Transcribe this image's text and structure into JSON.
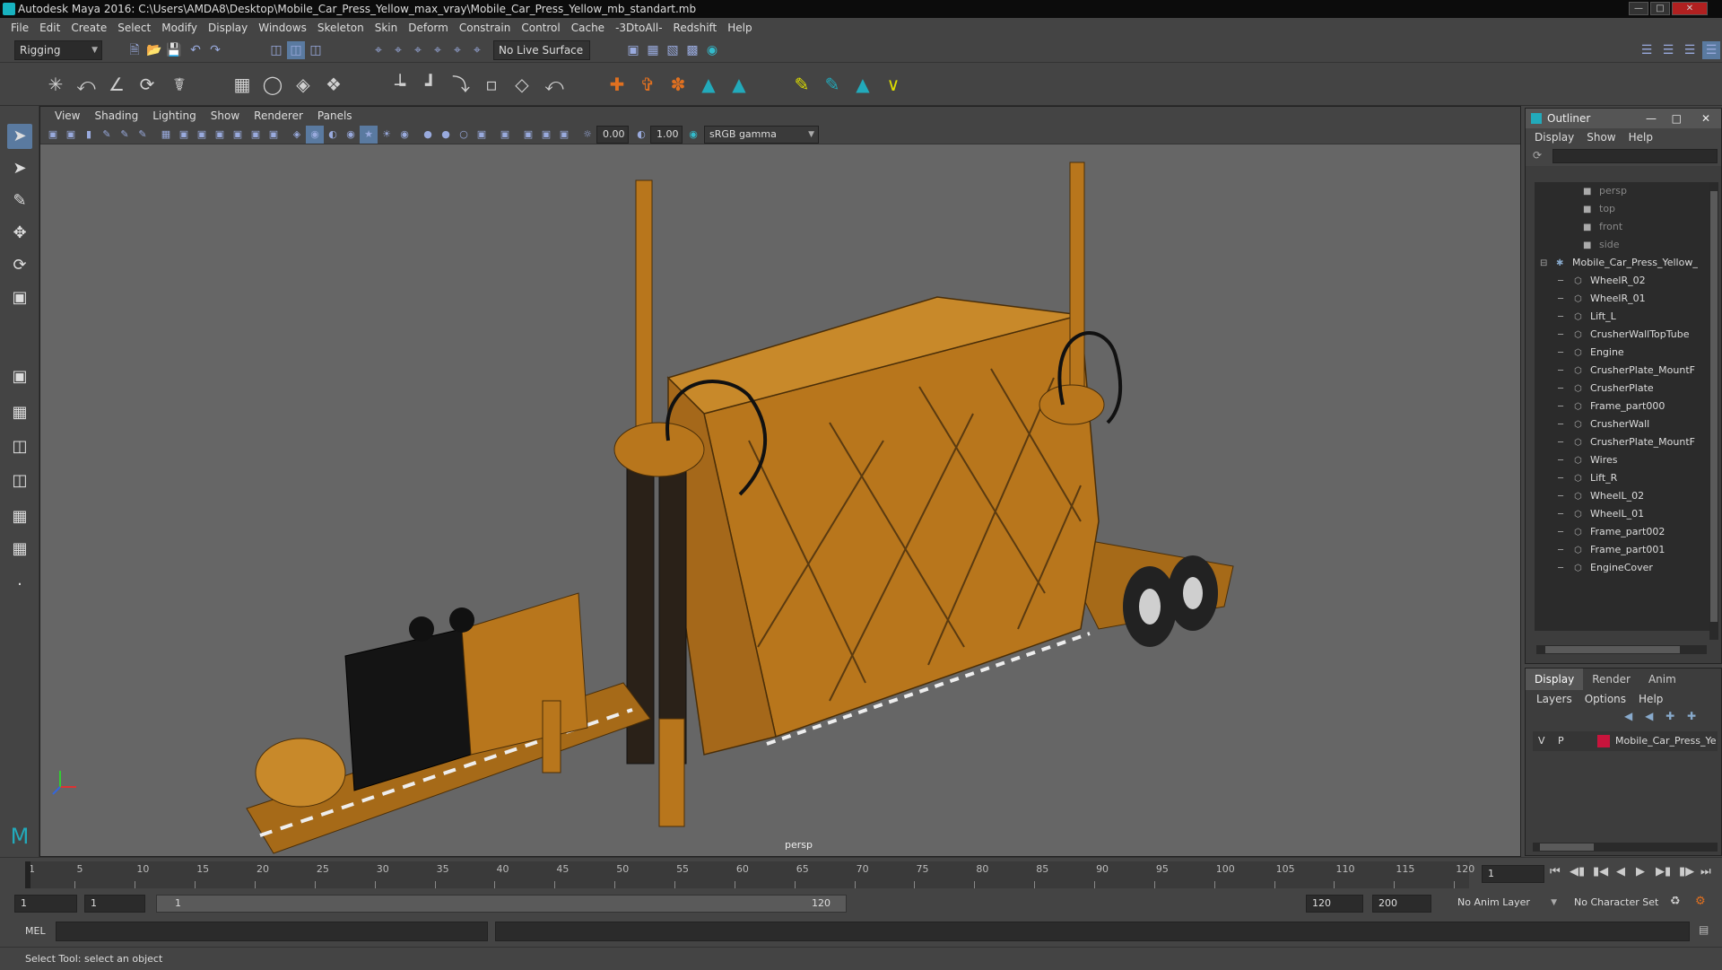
{
  "window": {
    "title": "Autodesk Maya 2016: C:\\Users\\AMDA8\\Desktop\\Mobile_Car_Press_Yellow_max_vray\\Mobile_Car_Press_Yellow_mb_standart.mb"
  },
  "menubar": [
    "File",
    "Edit",
    "Create",
    "Select",
    "Modify",
    "Display",
    "Windows",
    "Skeleton",
    "Skin",
    "Deform",
    "Constrain",
    "Control",
    "Cache",
    "-3DtoAll-",
    "Redshift",
    "Help"
  ],
  "statusline": {
    "mode": "Rigging",
    "live_surface": "No Live Surface"
  },
  "viewport": {
    "menu": [
      "View",
      "Shading",
      "Lighting",
      "Show",
      "Renderer",
      "Panels"
    ],
    "exposure": "0.00",
    "gamma": "1.00",
    "color_space": "sRGB gamma",
    "camera": "persp"
  },
  "outliner": {
    "title": "Outliner",
    "menu": [
      "Display",
      "Show",
      "Help"
    ],
    "cameras": [
      "persp",
      "top",
      "front",
      "side"
    ],
    "root": "Mobile_Car_Press_Yellow_",
    "children": [
      "WheelR_02",
      "WheelR_01",
      "Lift_L",
      "CrusherWallTopTube",
      "Engine",
      "CrusherPlate_MountF",
      "CrusherPlate",
      "Frame_part000",
      "CrusherWall",
      "CrusherPlate_MountF",
      "Wires",
      "Lift_R",
      "WheelL_02",
      "WheelL_01",
      "Frame_part002",
      "Frame_part001",
      "EngineCover"
    ]
  },
  "layers": {
    "tabs": [
      "Display",
      "Render",
      "Anim"
    ],
    "menu": [
      "Layers",
      "Options",
      "Help"
    ],
    "row": {
      "v": "V",
      "p": "P",
      "name": "Mobile_Car_Press_Yello",
      "color": "#c8143c"
    }
  },
  "timeline": {
    "ticks": [
      "1",
      "5",
      "10",
      "15",
      "20",
      "25",
      "30",
      "35",
      "40",
      "45",
      "50",
      "55",
      "60",
      "65",
      "70",
      "75",
      "80",
      "85",
      "90",
      "95",
      "100",
      "105",
      "110",
      "115",
      "120"
    ],
    "current_frame": "1"
  },
  "range": {
    "start": "1",
    "playback_start": "1",
    "slider_start": "1",
    "slider_end": "120",
    "playback_end": "120",
    "end": "200",
    "anim_layer": "No Anim Layer",
    "character_set": "No Character Set"
  },
  "command": {
    "lang": "MEL"
  },
  "help_line": "Select Tool: select an object",
  "colors": {
    "model": "#b8761c",
    "viewport_bg": "#666666"
  }
}
